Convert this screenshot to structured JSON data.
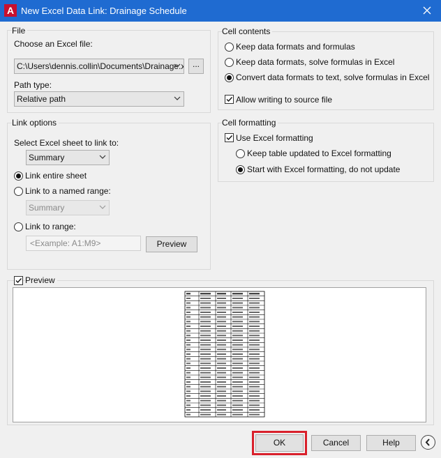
{
  "window": {
    "title": "New Excel Data Link: Drainage Schedule",
    "app_icon_letter": "A"
  },
  "file_group": {
    "legend": "File",
    "choose_label": "Choose an Excel file:",
    "file_path": "C:\\Users\\dennis.collin\\Documents\\Drainage.xls",
    "browse_label": "...",
    "path_type_label": "Path type:",
    "path_type_value": "Relative path"
  },
  "link_options": {
    "legend": "Link options",
    "select_sheet_label": "Select Excel sheet to link to:",
    "sheet_value": "Summary",
    "link_entire_sheet": "Link entire sheet",
    "link_named_range": "Link to a named range:",
    "named_range_value": "Summary",
    "link_to_range": "Link to range:",
    "range_placeholder": "<Example: A1:M9>",
    "preview_button": "Preview",
    "selected": "link_entire_sheet"
  },
  "cell_contents": {
    "legend": "Cell contents",
    "option1": "Keep data formats and formulas",
    "option2": "Keep data formats, solve formulas in Excel",
    "option3": "Convert data formats to text, solve formulas in Excel",
    "selected": "option3",
    "allow_writing": "Allow writing to source file",
    "allow_writing_checked": true
  },
  "cell_formatting": {
    "legend": "Cell formatting",
    "use_excel_formatting": "Use Excel formatting",
    "use_excel_formatting_checked": true,
    "keep_updated": "Keep table updated to Excel formatting",
    "start_with": "Start with Excel formatting, do not update",
    "selected": "start_with"
  },
  "preview": {
    "label": "Preview",
    "checked": true,
    "table_rows": 27,
    "table_cols": 5
  },
  "buttons": {
    "ok": "OK",
    "cancel": "Cancel",
    "help": "Help"
  },
  "colors": {
    "titlebar": "#1f6bd1",
    "highlight": "#d9202b"
  }
}
